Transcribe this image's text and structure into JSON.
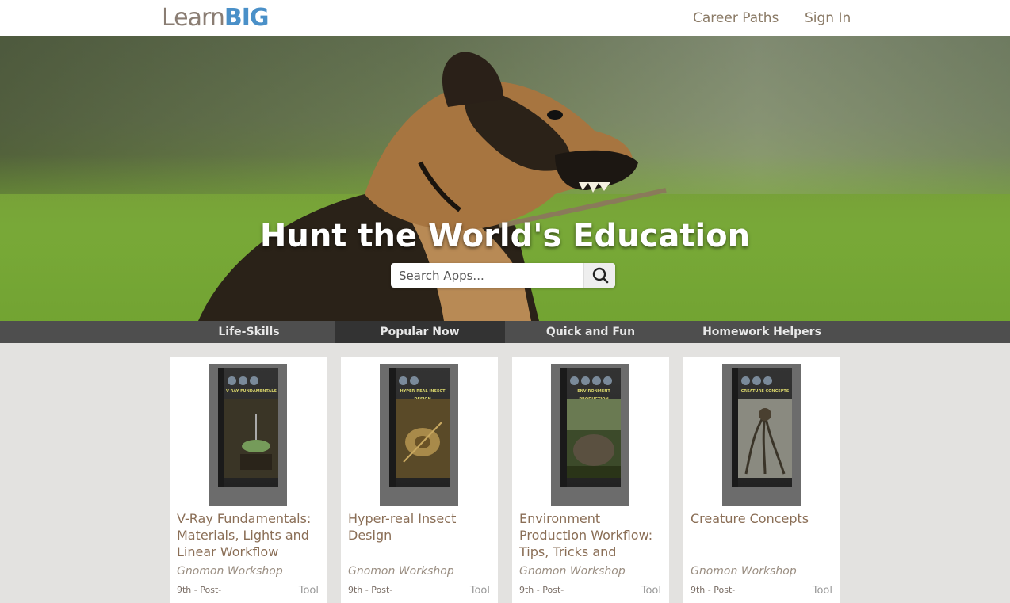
{
  "header": {
    "logo_learn": "Learn",
    "logo_big": "BIG",
    "nav": [
      {
        "label": "Career Paths"
      },
      {
        "label": "Sign In"
      }
    ]
  },
  "hero": {
    "title": "Hunt the World's Education",
    "search_placeholder": "Search Apps...",
    "search_icon": "search-icon"
  },
  "tabs": [
    {
      "label": "Life-Skills",
      "active": false
    },
    {
      "label": "Popular Now",
      "active": true
    },
    {
      "label": "Quick and Fun",
      "active": false
    },
    {
      "label": "Homework Helpers",
      "active": false
    }
  ],
  "cards": [
    {
      "title": "V-Ray Fundamentals: Materials, Lights and Linear Workflow",
      "cover_label": "V-RAY FUNDAMENTALS",
      "author": "Gnomon Workshop",
      "grade": "9th - Post-",
      "type": "Tool"
    },
    {
      "title": "Hyper-real Insect Design",
      "cover_label": "HYPER-REAL INSECT DESIGN",
      "author": "Gnomon Workshop",
      "grade": "9th - Post-",
      "type": "Tool"
    },
    {
      "title": "Environment Production Workflow: Tips, Tricks and",
      "cover_label": "ENVIRONMENT PRODUCTION WORKFLOW",
      "author": "Gnomon Workshop",
      "grade": "9th - Post-",
      "type": "Tool"
    },
    {
      "title": "Creature Concepts",
      "cover_label": "CREATURE CONCEPTS",
      "author": "Gnomon Workshop",
      "grade": "9th - Post-",
      "type": "Tool"
    }
  ]
}
